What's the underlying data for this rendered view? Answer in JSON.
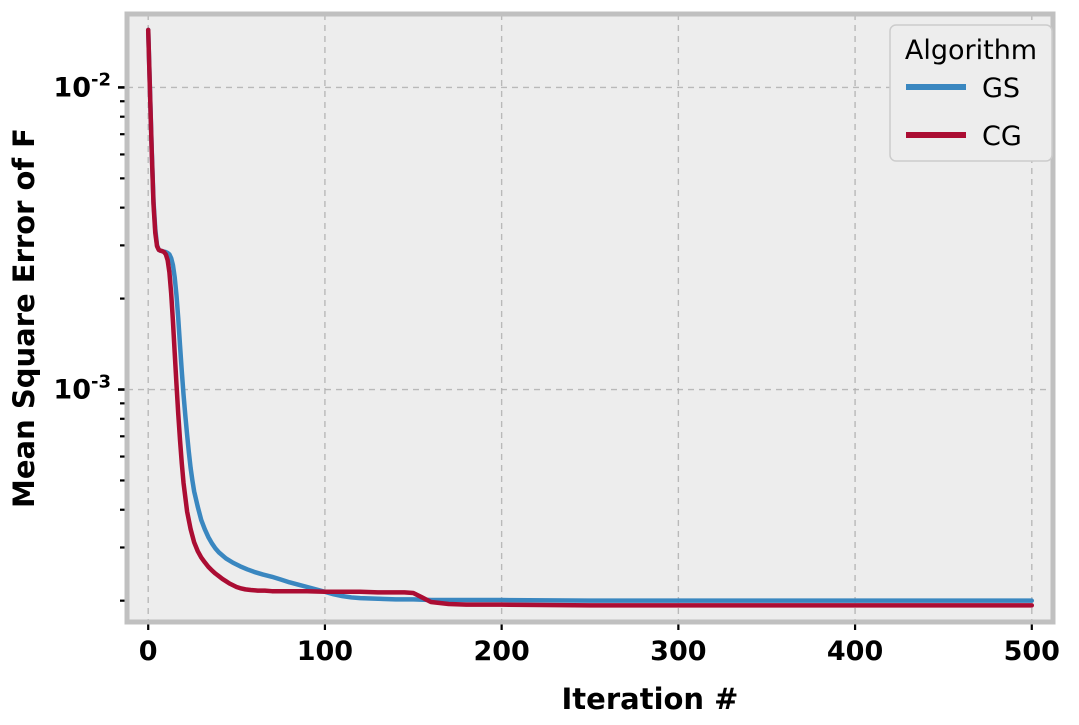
{
  "chart_data": {
    "type": "line",
    "title": "",
    "xlabel": "Iteration #",
    "ylabel": "Mean Square Error of F",
    "yscale": "log",
    "xscale": "linear",
    "xlim": [
      -12,
      512
    ],
    "ylim": [
      0.00017,
      0.0175
    ],
    "grid": true,
    "xticks": [
      0,
      100,
      200,
      300,
      400,
      500
    ],
    "xtick_labels": [
      "0",
      "100",
      "200",
      "300",
      "400",
      "500"
    ],
    "yticks": [
      0.01,
      0.001
    ],
    "ytick_labels": [
      "10⁻²",
      "10⁻³"
    ],
    "ytick_mantissa": [
      "10",
      "10"
    ],
    "ytick_exponent": [
      "-2",
      "-3"
    ],
    "legend": {
      "title": "Algorithm",
      "position": "upper right",
      "entries": [
        {
          "name": "GS",
          "color": "#3a87c0"
        },
        {
          "name": "CG",
          "color": "#ab0d33"
        }
      ]
    },
    "series": [
      {
        "name": "GS",
        "color": "#3a87c0",
        "linewidth": 4.5,
        "x": [
          0,
          1,
          2,
          3,
          4,
          5,
          6,
          7,
          8,
          9,
          10,
          11,
          12,
          13,
          14,
          15,
          16,
          17,
          18,
          19,
          20,
          21,
          22,
          23,
          24,
          25,
          26,
          28,
          30,
          32,
          34,
          36,
          38,
          40,
          44,
          48,
          52,
          56,
          60,
          65,
          70,
          75,
          80,
          85,
          90,
          95,
          100,
          105,
          110,
          115,
          120,
          130,
          140,
          150,
          160,
          180,
          200,
          250,
          300,
          350,
          400,
          450,
          500
        ],
        "y": [
          0.0155,
          0.0098,
          0.0062,
          0.0042,
          0.0034,
          0.003,
          0.0029,
          0.00288,
          0.00287,
          0.00286,
          0.00285,
          0.00283,
          0.0028,
          0.00272,
          0.00258,
          0.00235,
          0.00205,
          0.00172,
          0.0014,
          0.00115,
          0.00096,
          0.00082,
          0.00071,
          0.00062,
          0.00055,
          0.0005,
          0.00046,
          0.00041,
          0.00037,
          0.000345,
          0.000325,
          0.00031,
          0.000298,
          0.000289,
          0.000276,
          0.000267,
          0.00026,
          0.000254,
          0.000249,
          0.000244,
          0.00024,
          0.000235,
          0.00023,
          0.000226,
          0.000222,
          0.000218,
          0.000214,
          0.00021,
          0.000207,
          0.000205,
          0.000204,
          0.000203,
          0.000202,
          0.000202,
          0.000201,
          0.000201,
          0.000201,
          0.0002,
          0.0002,
          0.0002,
          0.0002,
          0.0002,
          0.0002
        ]
      },
      {
        "name": "CG",
        "color": "#ab0d33",
        "linewidth": 4.5,
        "x": [
          0,
          1,
          2,
          3,
          4,
          5,
          6,
          7,
          8,
          9,
          10,
          11,
          12,
          13,
          14,
          15,
          16,
          17,
          18,
          19,
          20,
          22,
          24,
          26,
          28,
          30,
          32,
          34,
          36,
          38,
          40,
          42,
          44,
          46,
          48,
          50,
          52,
          55,
          58,
          62,
          66,
          70,
          75,
          80,
          90,
          100,
          110,
          120,
          130,
          140,
          145,
          150,
          155,
          160,
          170,
          180,
          200,
          250,
          300,
          350,
          400,
          450,
          500
        ],
        "y": [
          0.0155,
          0.0097,
          0.0061,
          0.0041,
          0.0033,
          0.00298,
          0.0029,
          0.00288,
          0.00287,
          0.00285,
          0.0028,
          0.00268,
          0.00244,
          0.00208,
          0.00168,
          0.00132,
          0.00104,
          0.00083,
          0.00068,
          0.00057,
          0.00049,
          0.000395,
          0.000345,
          0.000312,
          0.000292,
          0.000278,
          0.000268,
          0.000259,
          0.000252,
          0.000246,
          0.000241,
          0.000236,
          0.000232,
          0.000228,
          0.000225,
          0.000222,
          0.00022,
          0.000218,
          0.000217,
          0.000216,
          0.000216,
          0.000215,
          0.000215,
          0.000215,
          0.000215,
          0.000214,
          0.000214,
          0.000214,
          0.000213,
          0.000213,
          0.000213,
          0.000212,
          0.000205,
          0.000198,
          0.000195,
          0.000194,
          0.000194,
          0.000193,
          0.000193,
          0.000193,
          0.000193,
          0.000193,
          0.000193
        ]
      }
    ]
  },
  "style": {
    "plot_background": "#ededed",
    "figure_background": "#ffffff",
    "grid_color": "#b0b0b0",
    "spine_color": "#c0c0c0",
    "tick_color": "#000000",
    "legend_background": "#ededed",
    "legend_border": "#cccccc"
  }
}
